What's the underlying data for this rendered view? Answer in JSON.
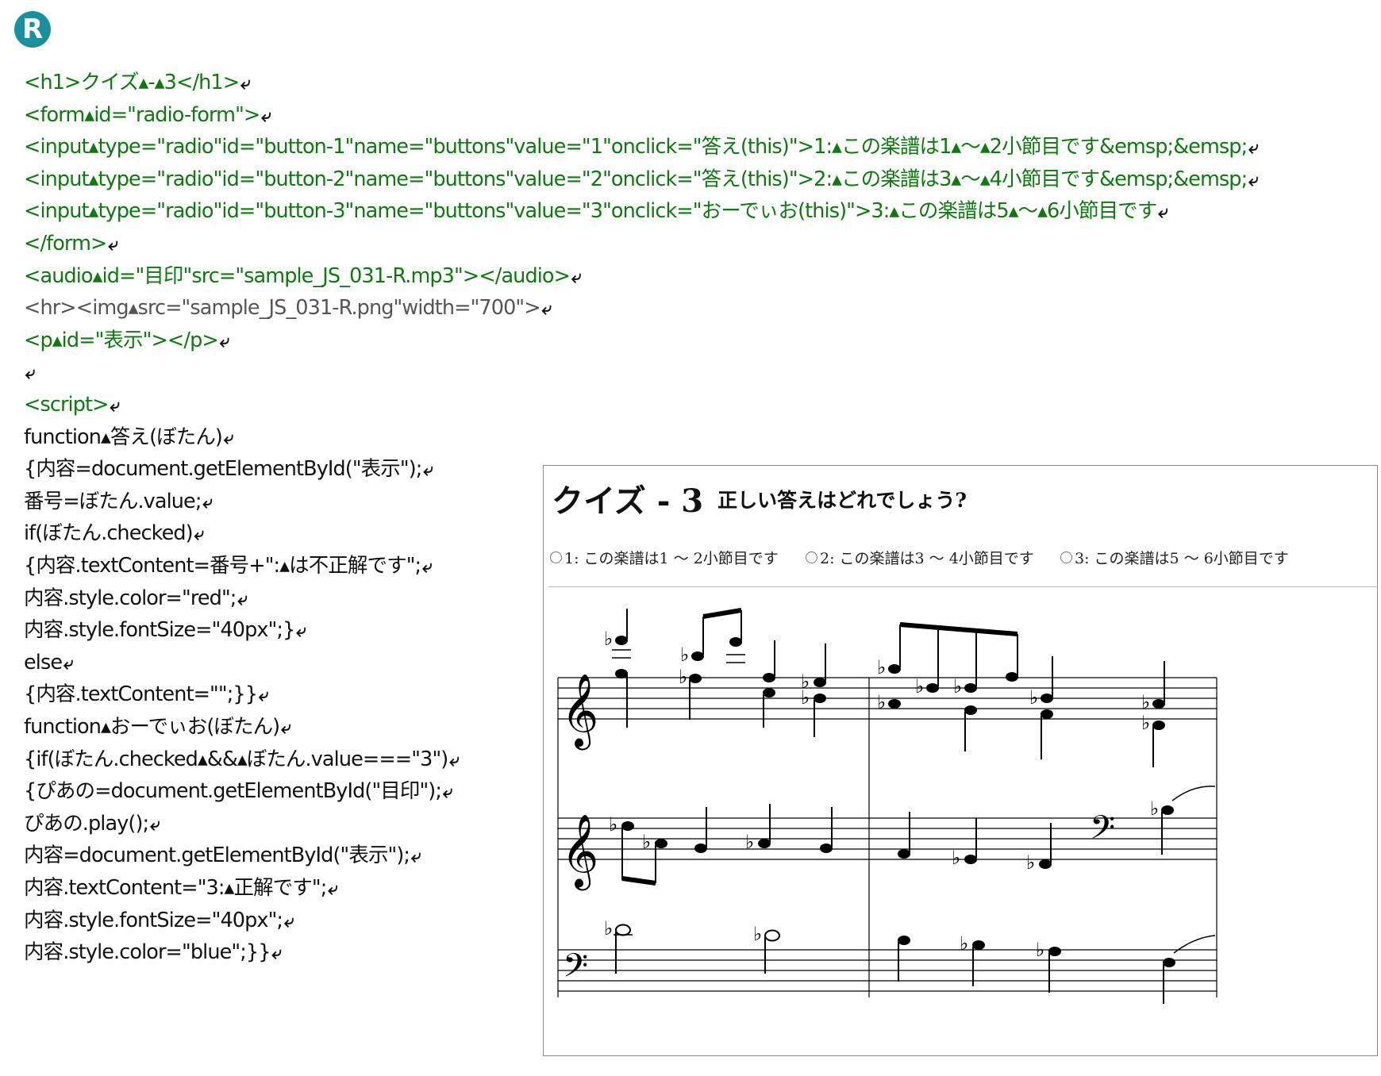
{
  "badge": {
    "letter": "R",
    "color": "#1a8f9e"
  },
  "colors": {
    "tag": "#0c7a0c",
    "img_tag": "#555555",
    "script": "#111111"
  },
  "code_lines": [
    {
      "text": "<h1>クイズ▴-▴3</h1>",
      "style": "green"
    },
    {
      "text": "<form▴id=\"radio-form\">",
      "style": "green"
    },
    {
      "text": "<input▴type=\"radio\"id=\"button-1\"name=\"buttons\"value=\"1\"onclick=\"答え(this)\">1:▴この楽譜は1▴〜▴2小節目です&emsp;&emsp;",
      "style": "green"
    },
    {
      "text": "<input▴type=\"radio\"id=\"button-2\"name=\"buttons\"value=\"2\"onclick=\"答え(this)\">2:▴この楽譜は3▴〜▴4小節目です&emsp;&emsp;",
      "style": "green"
    },
    {
      "text": "<input▴type=\"radio\"id=\"button-3\"name=\"buttons\"value=\"3\"onclick=\"おーでぃお(this)\">3:▴この楽譜は5▴〜▴6小節目です",
      "style": "green"
    },
    {
      "text": "</form>",
      "style": "green"
    },
    {
      "text": "<audio▴id=\"目印\"src=\"sample_JS_031-R.mp3\"></audio>",
      "style": "green"
    },
    {
      "text": "<hr><img▴src=\"sample_JS_031-R.png\"width=\"700\">",
      "style": "gray"
    },
    {
      "text": "<p▴id=\"表示\"></p>",
      "style": "green"
    },
    {
      "text": "",
      "style": "black"
    },
    {
      "text": "<script>",
      "style": "green"
    },
    {
      "text": "function▴答え(ぼたん)",
      "style": "black"
    },
    {
      "text": "{内容=document.getElementById(\"表示\");",
      "style": "black"
    },
    {
      "text": "番号=ぼたん.value;",
      "style": "black"
    },
    {
      "text": "if(ぼたん.checked)",
      "style": "black"
    },
    {
      "text": "{内容.textContent=番号+\":▴は不正解です\";",
      "style": "black"
    },
    {
      "text": "内容.style.color=\"red\";",
      "style": "black"
    },
    {
      "text": "内容.style.fontSize=\"40px\";}",
      "style": "black"
    },
    {
      "text": "else",
      "style": "black"
    },
    {
      "text": "{内容.textContent=\"\";}}",
      "style": "black"
    },
    {
      "text": "function▴おーでぃお(ぼたん)",
      "style": "black"
    },
    {
      "text": "{if(ぼたん.checked▴&&▴ぼたん.value===\"3\")",
      "style": "black"
    },
    {
      "text": "{ぴあの=document.getElementById(\"目印\");",
      "style": "black"
    },
    {
      "text": "ぴあの.play();",
      "style": "black"
    },
    {
      "text": "内容=document.getElementById(\"表示\");",
      "style": "black"
    },
    {
      "text": "内容.textContent=\"3:▴正解です\";",
      "style": "black"
    },
    {
      "text": "内容.style.fontSize=\"40px\";",
      "style": "black"
    },
    {
      "text": "内容.style.color=\"blue\";}}",
      "style": "black"
    }
  ],
  "return_mark": "⤶",
  "preview": {
    "title": "クイズ - 3",
    "question": "正しい答えはどれでしょう?",
    "options": [
      "1: この楽譜は1 〜 2小節目です",
      "2: この楽譜は3 〜 4小節目です",
      "3: この楽譜は5 〜 6小節目です"
    ]
  }
}
